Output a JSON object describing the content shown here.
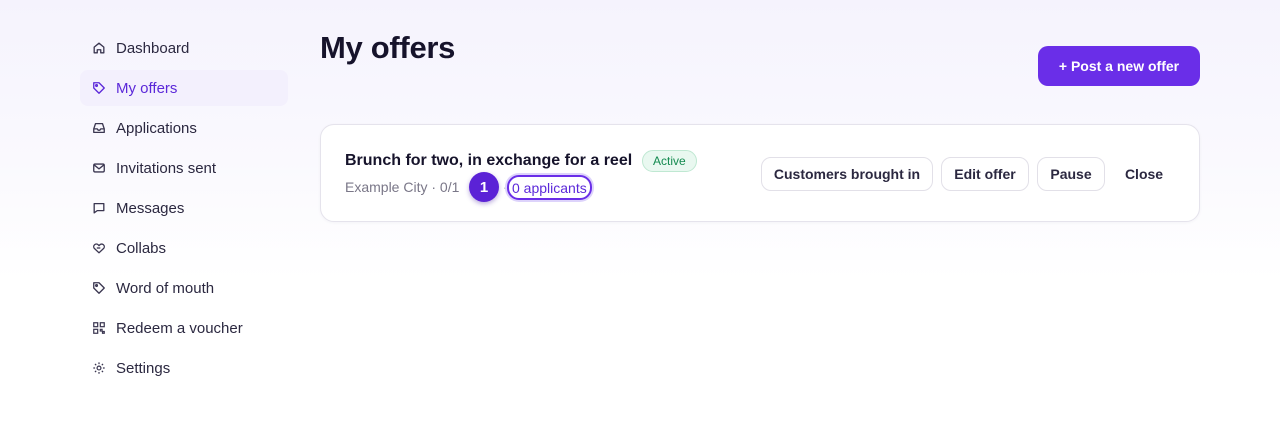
{
  "sidebar": {
    "items": [
      {
        "label": "Dashboard",
        "icon": "home-icon"
      },
      {
        "label": "My offers",
        "icon": "tag-icon",
        "active": true
      },
      {
        "label": "Applications",
        "icon": "inbox-icon"
      },
      {
        "label": "Invitations sent",
        "icon": "mail-icon"
      },
      {
        "label": "Messages",
        "icon": "message-icon"
      },
      {
        "label": "Collabs",
        "icon": "handshake-icon"
      },
      {
        "label": "Word of mouth",
        "icon": "tag-icon"
      },
      {
        "label": "Redeem a voucher",
        "icon": "qr-icon"
      },
      {
        "label": "Settings",
        "icon": "gear-icon"
      }
    ]
  },
  "header": {
    "title": "My offers",
    "post_button": "+ Post a new offer"
  },
  "offer": {
    "title": "Brunch for two, in exchange for a reel",
    "status": "Active",
    "meta": "Example City · 0/1",
    "marker": "1",
    "separator": "·",
    "applicants": "0 applicants",
    "actions": {
      "customers": "Customers brought in",
      "edit": "Edit offer",
      "pause": "Pause",
      "close": "Close"
    }
  },
  "colors": {
    "accent": "#6a2ee8",
    "active_nav_bg": "#f3f0fd",
    "badge_green": "#138a4f"
  }
}
